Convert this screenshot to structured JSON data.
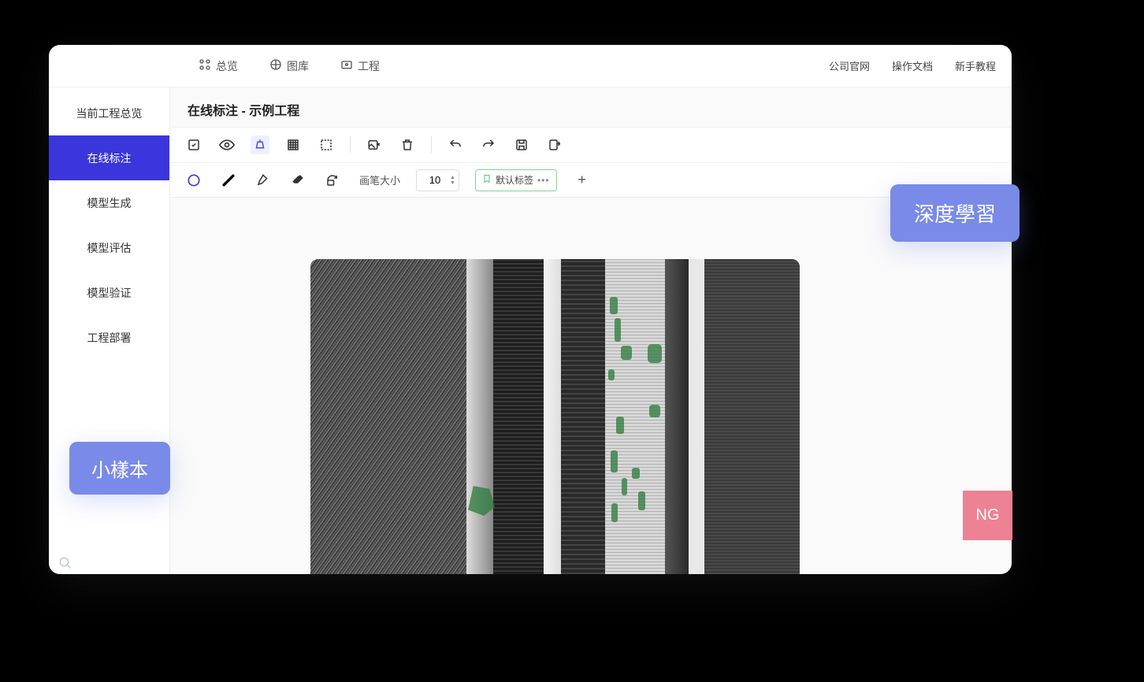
{
  "topnav": {
    "overview": "总览",
    "gallery": "图库",
    "project": "工程"
  },
  "topright": {
    "website": "公司官网",
    "docs": "操作文档",
    "tutorial": "新手教程"
  },
  "sidebar": {
    "items": [
      {
        "label": "当前工程总览"
      },
      {
        "label": "在线标注"
      },
      {
        "label": "模型生成"
      },
      {
        "label": "模型评估"
      },
      {
        "label": "模型验证"
      },
      {
        "label": "工程部署"
      }
    ]
  },
  "page_title": "在线标注 - 示例工程",
  "brush": {
    "label": "画笔大小",
    "value": "10"
  },
  "tag": {
    "label": "默认标签"
  },
  "badges": {
    "small_sample": "小樣本",
    "deep_learning": "深度學習",
    "ng": "NG"
  }
}
